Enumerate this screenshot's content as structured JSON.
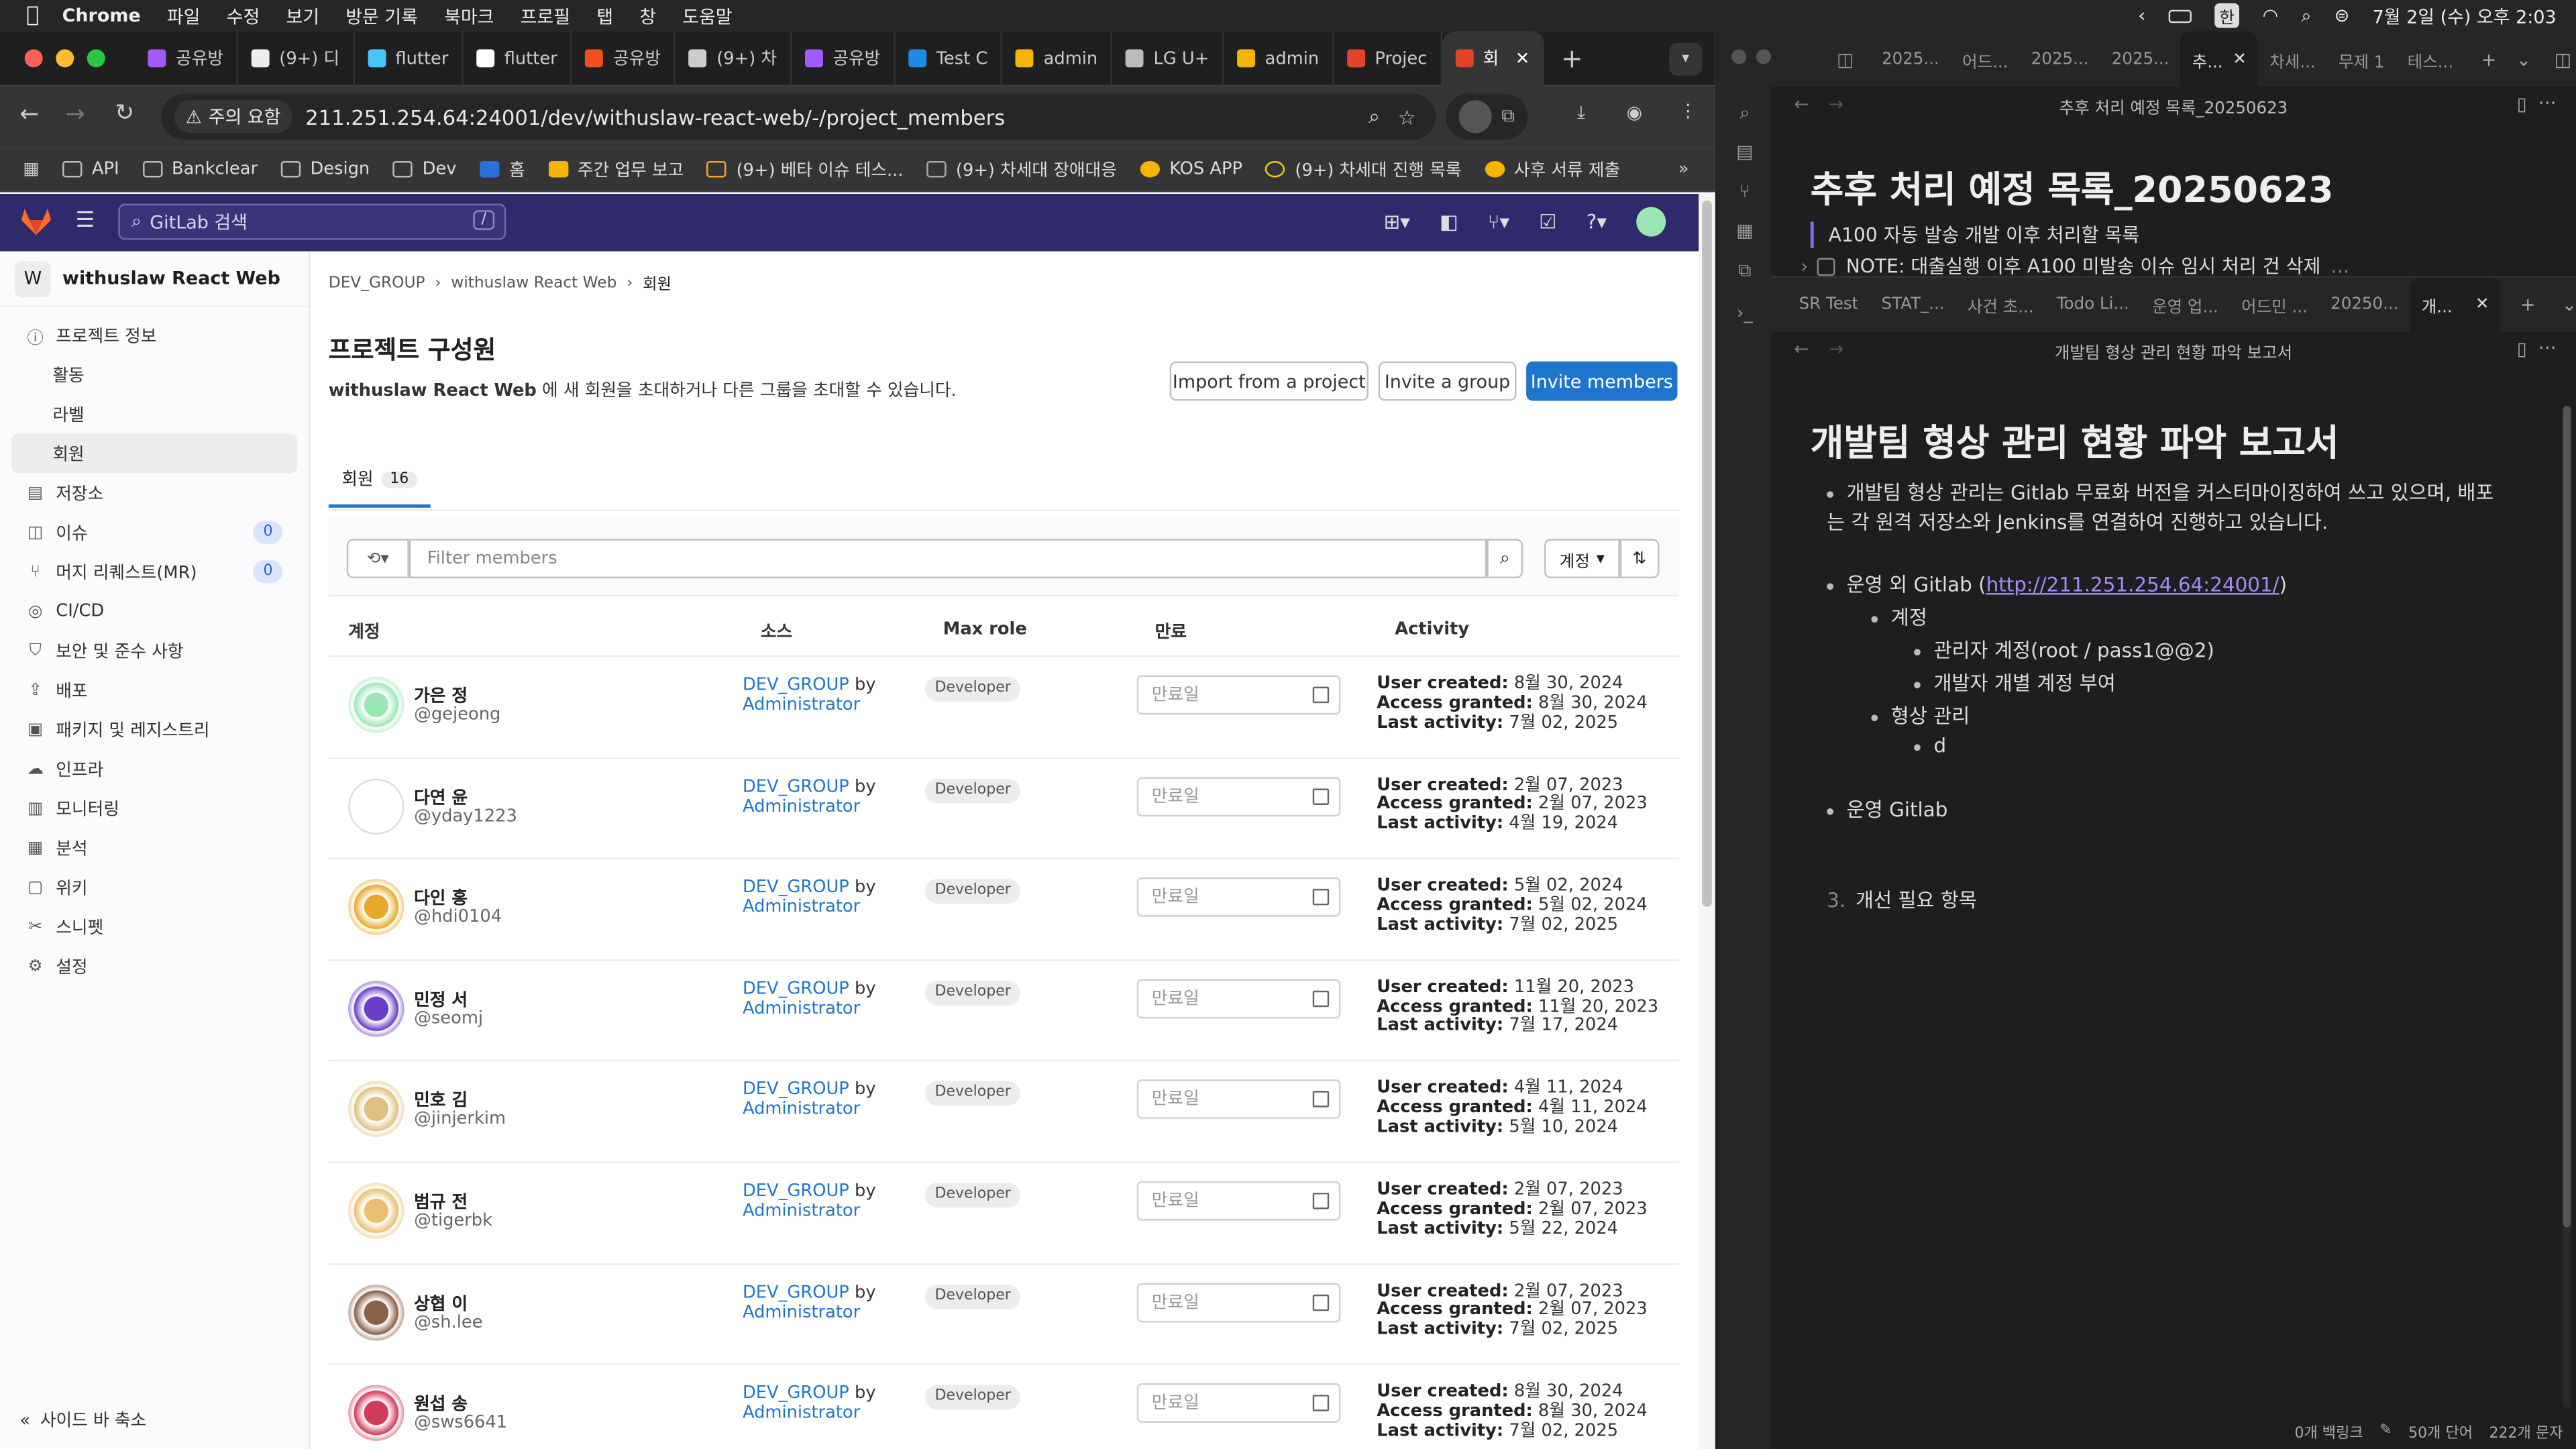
{
  "menubar": {
    "app": "Chrome",
    "items": [
      "파일",
      "수정",
      "보기",
      "방문 기록",
      "북마크",
      "프로필",
      "탭",
      "창",
      "도움말"
    ],
    "ime": "한",
    "datetime": "7월 2일 (수) 오후 2:03"
  },
  "browser": {
    "tabs": [
      {
        "label": "공유방",
        "color": "#a259ff"
      },
      {
        "label": "(9+) 디",
        "color": "#eeeeee"
      },
      {
        "label": "flutter",
        "color": "#47c5fb"
      },
      {
        "label": "flutter",
        "color": "#ffffff"
      },
      {
        "label": "공유방",
        "color": "#f24e1e"
      },
      {
        "label": "(9+) 차",
        "color": "#cccccc"
      },
      {
        "label": "공유방",
        "color": "#a259ff"
      },
      {
        "label": "Test C",
        "color": "#1e88e5"
      },
      {
        "label": "admin",
        "color": "#f5b400"
      },
      {
        "label": "LG U+",
        "color": "#bbbbbb"
      },
      {
        "label": "admin",
        "color": "#f5b400"
      },
      {
        "label": "Projec",
        "color": "#e24329"
      },
      {
        "label": "회",
        "color": "#e24329"
      }
    ],
    "security_label": "주의 요함",
    "url": "211.251.254.64:24001/dev/withuslaw-react-web/-/project_members",
    "bookmarks": [
      "API",
      "Bankclear",
      "Design",
      "Dev",
      "홈",
      "주간 업무 보고",
      "(9+) 베타 이슈 테스...",
      "(9+) 차세대 장애대응",
      "KOS APP",
      "(9+) 차세대 진행 목록",
      "사후 서류 제출"
    ]
  },
  "gitlab": {
    "search_placeholder": "GitLab 검색",
    "search_shortcut": "/",
    "project_initial": "W",
    "project_name": "withuslaw React Web",
    "sidebar": [
      {
        "label": "프로젝트 정보",
        "icon": "ⓘ",
        "type": "section"
      },
      {
        "label": "활동",
        "type": "sub"
      },
      {
        "label": "라벨",
        "type": "sub"
      },
      {
        "label": "회원",
        "type": "active"
      },
      {
        "label": "저장소",
        "icon": "▤"
      },
      {
        "label": "이슈",
        "icon": "◫",
        "badge": "0"
      },
      {
        "label": "머지 리퀘스트(MR)",
        "icon": "⑂",
        "badge": "0"
      },
      {
        "label": "CI/CD",
        "icon": "◎"
      },
      {
        "label": "보안 및 준수 사항",
        "icon": "⛉"
      },
      {
        "label": "배포",
        "icon": "⇪"
      },
      {
        "label": "패키지 및 레지스트리",
        "icon": "▣"
      },
      {
        "label": "인프라",
        "icon": "☁"
      },
      {
        "label": "모니터링",
        "icon": "▥"
      },
      {
        "label": "분석",
        "icon": "▦"
      },
      {
        "label": "위키",
        "icon": "▢"
      },
      {
        "label": "스니펫",
        "icon": "✂"
      },
      {
        "label": "설정",
        "icon": "⚙"
      }
    ],
    "collapse_label": "사이드 바 축소",
    "breadcrumb": [
      "DEV_GROUP",
      "withuslaw React Web",
      "회원"
    ],
    "title": "프로젝트 구성원",
    "desc_project": "withuslaw React Web",
    "desc_rest": " 에 새 회원을 초대하거나 다른 그룹을 초대할 수 있습니다.",
    "buttons": {
      "import": "Import from a project",
      "invite_group": "Invite a group",
      "invite_members": "Invite members"
    },
    "tab_label": "회원",
    "tab_count": "16",
    "filter_placeholder": "Filter members",
    "sort_label": "계정",
    "columns": [
      "계정",
      "소스",
      "Max role",
      "만료",
      "Activity"
    ],
    "labels": {
      "by": " by",
      "expiry_placeholder": "만료일",
      "user_created": "User created:",
      "access_granted": "Access granted:",
      "last_activity": "Last activity:"
    },
    "members": [
      {
        "name": "가은 정",
        "handle": "@gejeong",
        "source": "DEV_GROUP",
        "by": "Administrator",
        "role": "Developer",
        "created": "8월 30, 2024",
        "granted": "8월 30, 2024",
        "last": "7월 02, 2025",
        "avatar_color": "#9be7b4"
      },
      {
        "name": "다연 윤",
        "handle": "@yday1223",
        "source": "DEV_GROUP",
        "by": "Administrator",
        "role": "Developer",
        "created": "2월 07, 2023",
        "granted": "2월 07, 2023",
        "last": "4월 19, 2024",
        "avatar_color": "#ffffff"
      },
      {
        "name": "다인 홍",
        "handle": "@hdi0104",
        "source": "DEV_GROUP",
        "by": "Administrator",
        "role": "Developer",
        "created": "5월 02, 2024",
        "granted": "5월 02, 2024",
        "last": "7월 02, 2025",
        "avatar_color": "#e8a92a"
      },
      {
        "name": "민정 서",
        "handle": "@seomj",
        "source": "DEV_GROUP",
        "by": "Administrator",
        "role": "Developer",
        "created": "11월 20, 2023",
        "granted": "11월 20, 2023",
        "last": "7월 17, 2024",
        "avatar_color": "#6a3fc8"
      },
      {
        "name": "민호 김",
        "handle": "@jinjerkim",
        "source": "DEV_GROUP",
        "by": "Administrator",
        "role": "Developer",
        "created": "4월 11, 2024",
        "granted": "4월 11, 2024",
        "last": "5월 10, 2024",
        "avatar_color": "#e0c080"
      },
      {
        "name": "범규 전",
        "handle": "@tigerbk",
        "source": "DEV_GROUP",
        "by": "Administrator",
        "role": "Developer",
        "created": "2월 07, 2023",
        "granted": "2월 07, 2023",
        "last": "5월 22, 2024",
        "avatar_color": "#e8c070"
      },
      {
        "name": "상협 이",
        "handle": "@sh.lee",
        "source": "DEV_GROUP",
        "by": "Administrator",
        "role": "Developer",
        "created": "2월 07, 2023",
        "granted": "2월 07, 2023",
        "last": "7월 02, 2025",
        "avatar_color": "#8a6048"
      },
      {
        "name": "원섭 송",
        "handle": "@sws6641",
        "source": "DEV_GROUP",
        "by": "Administrator",
        "role": "Developer",
        "created": "8월 30, 2024",
        "granted": "8월 30, 2024",
        "last": "7월 02, 2025",
        "avatar_color": "#d23a5a"
      }
    ]
  },
  "obsidian": {
    "top_tabs": [
      "2025...",
      "어드...",
      "2025...",
      "2025...",
      "추...",
      "차세...",
      "무제 1",
      "테스..."
    ],
    "top_title": "추후 처리 예정 목록_20250623",
    "top_heading": "추후 처리 예정 목록_20250623",
    "top_quote": "A100 자동 발송 개발 이후 처리할 목록",
    "top_task": "NOTE: 대출실행 이후 A100 미발송 이슈 임시 처리 건 삭제",
    "bottom_tabs": [
      "SR Test",
      "STAT_...",
      "사건 초...",
      "Todo Li...",
      "운영 업...",
      "어드민 ...",
      "20250...",
      "개..."
    ],
    "bottom_title": "개발팀 형상 관리 현황 파악 보고서",
    "heading": "개발팀 형상 관리 현황 파악 보고서",
    "p1": "개발팀 형상 관리는 Gitlab 무료화 버전을 커스터마이징하여 쓰고 있으며, 배포는 각 원격 저장소와 Jenkins를 연결하여 진행하고 있습니다.",
    "ops_label": "운영 외 Gitlab (",
    "ops_link": "http://211.251.254.64:24001/",
    "ops_close": ")",
    "account": "계정",
    "admin_account": "관리자 계정(root / pass1@@2)",
    "dev_account": "개발자 개별 계정 부여",
    "config": "형상 관리",
    "d": "d",
    "ops_gitlab": "운영 Gitlab",
    "num3": "3.",
    "improve": "개선 필요 항목",
    "status_backlinks": "0개 백링크",
    "status_words": "50개 단어",
    "status_chars": "222개 문자"
  }
}
